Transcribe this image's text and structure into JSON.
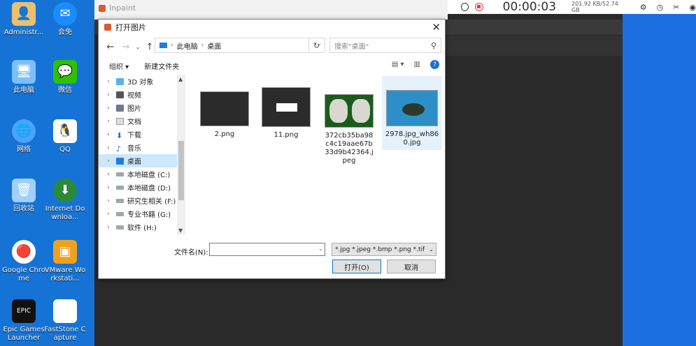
{
  "desktop": {
    "icons": [
      {
        "label": "Administr..."
      },
      {
        "label": "会免"
      },
      {
        "label": "此电脑"
      },
      {
        "label": "微信"
      },
      {
        "label": "网络"
      },
      {
        "label": "QQ"
      },
      {
        "label": "回收站"
      },
      {
        "label": "Internet Downloa..."
      },
      {
        "label": "Google Chrome"
      },
      {
        "label": "VMware Workstati..."
      },
      {
        "label": "Epic Games Launcher"
      },
      {
        "label": "FastStone Capture"
      }
    ]
  },
  "app": {
    "title": "Inpaint"
  },
  "recorder": {
    "time": "00:00:03",
    "stats": "201.92 KB/52.74 GB"
  },
  "dialog": {
    "title": "打开图片",
    "address": {
      "root": "此电脑",
      "current": "桌面"
    },
    "search_placeholder": "搜索\"桌面\"",
    "toolbar": {
      "organize": "组织 ▾",
      "new_folder": "新建文件夹"
    },
    "tree": [
      {
        "label": "3D 对象",
        "selected": false
      },
      {
        "label": "视频",
        "selected": false
      },
      {
        "label": "图片",
        "selected": false
      },
      {
        "label": "文档",
        "selected": false
      },
      {
        "label": "下载",
        "selected": false
      },
      {
        "label": "音乐",
        "selected": false
      },
      {
        "label": "桌面",
        "selected": true
      },
      {
        "label": "本地磁盘 (C:)",
        "selected": false
      },
      {
        "label": "本地磁盘 (D:)",
        "selected": false
      },
      {
        "label": "研究生相关 (F:)",
        "selected": false
      },
      {
        "label": "专业书籍 (G:)",
        "selected": false
      },
      {
        "label": "软件 (H:)",
        "selected": false
      }
    ],
    "files": [
      {
        "name": "2.png"
      },
      {
        "name": "11.png"
      },
      {
        "name": "372cb35ba98c4c19aae67b33d9b42364.jpeg"
      },
      {
        "name": "2978.jpg_wh860.jpg"
      }
    ],
    "filename_label": "文件名(N):",
    "filename_value": "",
    "filetype": "*.jpg *.jpeg *.bmp *.png *.tif",
    "open_button": "打开(O)",
    "cancel_button": "取消"
  },
  "colors": {
    "desktop": "#1673d6",
    "accent": "#0078d7",
    "selection": "#cce8ff"
  }
}
